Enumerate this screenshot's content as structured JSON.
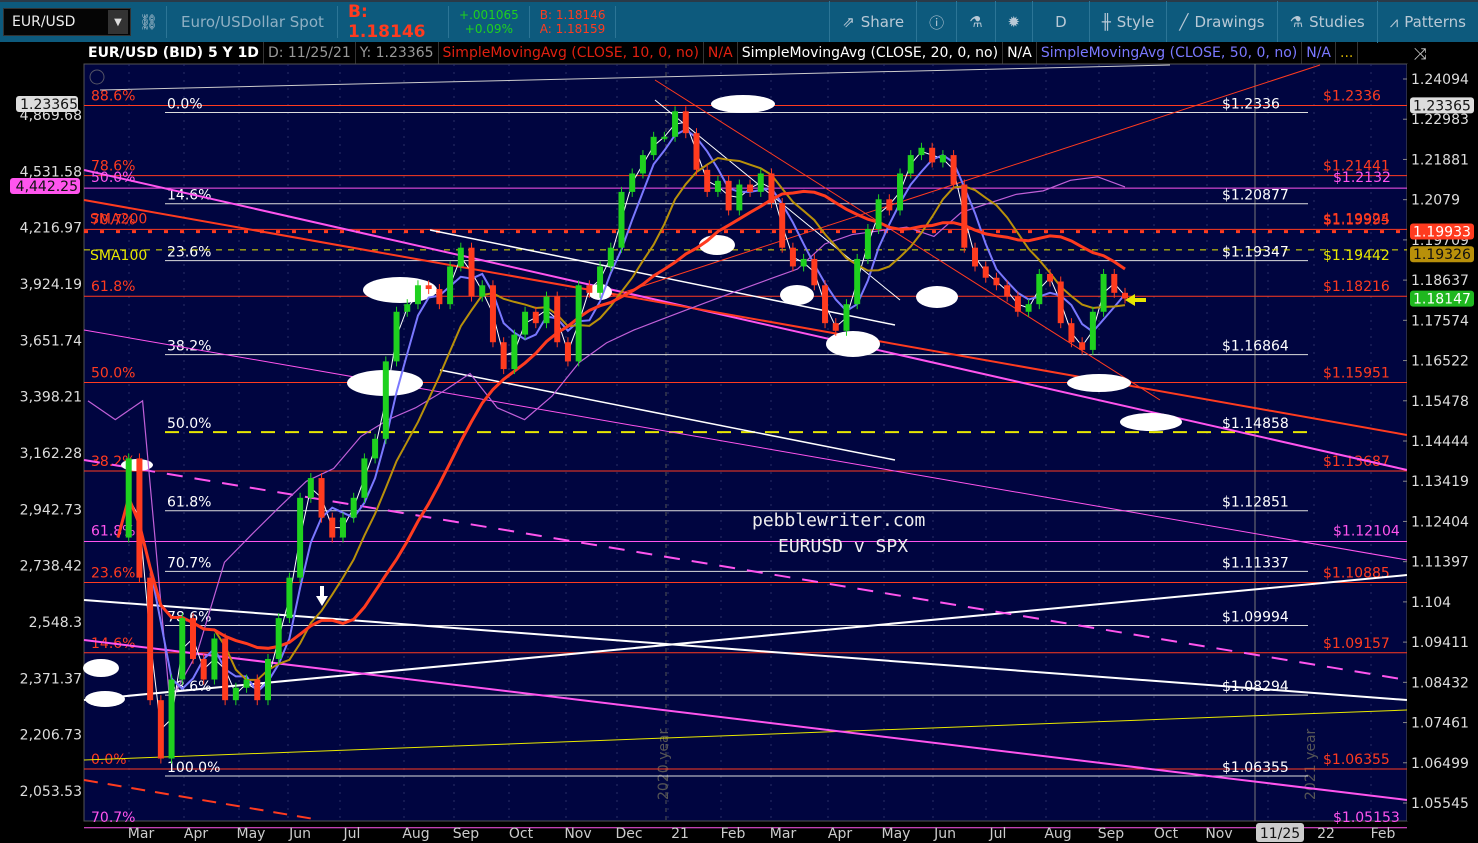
{
  "toolbar": {
    "symbol": "EUR/USD",
    "description": "Euro/USDollar Spot",
    "bid_big": "B: 1.18146",
    "change": "+.001065",
    "change_pct": "+0.09%",
    "bid": "B: 1.18146",
    "ask": "A: 1.18159",
    "buttons": [
      {
        "label": "Share",
        "icon": "share-icon"
      },
      {
        "label": "",
        "icon": "info-icon"
      },
      {
        "label": "",
        "icon": "flask-icon"
      },
      {
        "label": "",
        "icon": "gear-icon"
      },
      {
        "label": "D",
        "icon": ""
      },
      {
        "label": "Style",
        "icon": "candle-icon"
      },
      {
        "label": "Drawings",
        "icon": "pencil-icon"
      },
      {
        "label": "Studies",
        "icon": "flask-icon"
      },
      {
        "label": "Patterns",
        "icon": "patterns-icon"
      }
    ]
  },
  "chart_header": {
    "title": "EUR/USD (BID) 5 Y 1D",
    "date": "D: 11/25/21",
    "y_value": "Y: 1.23365",
    "sma10": "SimpleMovingAvg (CLOSE, 10, 0, no)",
    "sma10_val": "N/A",
    "sma20": "SimpleMovingAvg (CLOSE, 20, 0, no)",
    "sma20_val": "N/A",
    "sma50": "SimpleMovingAvg (CLOSE, 50, 0, no)",
    "sma50_val": "N/A",
    "more": "..."
  },
  "colors": {
    "red": "#ff3b1f",
    "magenta": "#ff55ee",
    "yellow": "#e8e800",
    "green": "#1fd11f",
    "blue": "#7a78ff",
    "gold": "#b8900a"
  },
  "chart_data": {
    "type": "line",
    "title": "EUR/USD (BID) 5 Y 1D",
    "watermark": [
      "pebblewriter.com",
      "EURUSD v SPX"
    ],
    "year_labels": [
      "2020 year",
      "2021 year"
    ],
    "right_axis": {
      "scale": "log",
      "range": [
        1.05545,
        1.24094
      ],
      "ticks": [
        "1.24094",
        "1.22983",
        "1.21881",
        "1.2079",
        "1.19709",
        "1.18637",
        "1.17574",
        "1.16522",
        "1.15478",
        "1.14444",
        "1.13419",
        "1.12404",
        "1.11397",
        "1.104",
        "1.09411",
        "1.08432",
        "1.07461",
        "1.06499",
        "1.05545"
      ]
    },
    "left_axis": {
      "scale": "log",
      "range": [
        2053.53,
        4869.68
      ],
      "ticks": [
        "4,869.68",
        "4,531.58",
        "4,216.97",
        "3,924.19",
        "3,651.74",
        "3,398.21",
        "3,162.28",
        "2,942.73",
        "2,738.42",
        "2,548.3",
        "2,371.37",
        "2,206.73",
        "2,053.53"
      ]
    },
    "x_ticks": [
      "Mar",
      "Apr",
      "May",
      "Jun",
      "Jul",
      "Aug",
      "Sep",
      "Oct",
      "Nov",
      "Dec",
      "21",
      "Feb",
      "Mar",
      "Apr",
      "May",
      "Jun",
      "Jul",
      "Aug",
      "Sep",
      "Oct",
      "Nov",
      "11/25",
      "22",
      "Feb"
    ],
    "series": [
      {
        "name": "EUR/USD",
        "axis": "right",
        "values": [
          1.12,
          1.14,
          1.11,
          1.08,
          1.066,
          1.085,
          1.1,
          1.09,
          1.085,
          1.095,
          1.08,
          1.083,
          1.085,
          1.08,
          1.09,
          1.1,
          1.11,
          1.13,
          1.135,
          1.125,
          1.12,
          1.125,
          1.13,
          1.14,
          1.145,
          1.165,
          1.178,
          1.18,
          1.185,
          1.184,
          1.18,
          1.19,
          1.195,
          1.182,
          1.185,
          1.17,
          1.163,
          1.172,
          1.178,
          1.175,
          1.182,
          1.17,
          1.165,
          1.185,
          1.183,
          1.19,
          1.195,
          1.21,
          1.215,
          1.22,
          1.225,
          1.225,
          1.232,
          1.226,
          1.216,
          1.21,
          1.213,
          1.205,
          1.212,
          1.21,
          1.215,
          1.207,
          1.195,
          1.19,
          1.192,
          1.185,
          1.175,
          1.173,
          1.18,
          1.192,
          1.2,
          1.208,
          1.205,
          1.215,
          1.22,
          1.222,
          1.218,
          1.22,
          1.212,
          1.195,
          1.19,
          1.187,
          1.185,
          1.182,
          1.178,
          1.18,
          1.188,
          1.186,
          1.175,
          1.17,
          1.168,
          1.178,
          1.188,
          1.183,
          1.1815
        ]
      },
      {
        "name": "SPX",
        "axis": "left",
        "values": [
          3380,
          3300,
          3380,
          2300,
          2450,
          2750,
          2850,
          2950,
          3050,
          3100,
          3230,
          3300,
          3350,
          3420,
          3500,
          3350,
          3300,
          3400,
          3550,
          3640,
          3700,
          3750,
          3800,
          3850,
          3900,
          3950,
          4000,
          4130,
          4180,
          4200,
          4220,
          4170,
          4300,
          4350,
          4400,
          4420,
          4480,
          4500,
          4442
        ]
      }
    ],
    "fib_white": [
      {
        "pct": "0.0%",
        "price": "$1.2336",
        "v": 1.2336
      },
      {
        "pct": "14.6%",
        "price": "$1.20877",
        "v": 1.2087
      },
      {
        "pct": "23.6%",
        "price": "$1.19347",
        "v": 1.1934
      },
      {
        "pct": "38.2%",
        "price": "$1.16864",
        "v": 1.1686
      },
      {
        "pct": "50.0%",
        "price": "$1.14858",
        "v": 1.1485
      },
      {
        "pct": "61.8%",
        "price": "$1.12851",
        "v": 1.1285
      },
      {
        "pct": "70.7%",
        "price": "$1.11337",
        "v": 1.1133
      },
      {
        "pct": "78.6%",
        "price": "$1.09994",
        "v": 1.0999
      },
      {
        "pct": "88.6%",
        "price": "$1.08294",
        "v": 1.0829
      },
      {
        "pct": "100.0%",
        "price": "$1.06355",
        "v": 1.0635
      }
    ],
    "fib_red": [
      {
        "pct": "88.6%",
        "price": "$1.2336",
        "v": 1.2336
      },
      {
        "pct": "78.6%",
        "price": "$1.21441",
        "v": 1.2144
      },
      {
        "pct": "70.7%",
        "price": "$1.19995",
        "v": 1.1999
      },
      {
        "pct": "61.8%",
        "price": "$1.18216",
        "v": 1.1821
      },
      {
        "pct": "50.0%",
        "price": "$1.15951",
        "v": 1.1595
      },
      {
        "pct": "38.2%",
        "price": "$1.13687",
        "v": 1.1368
      },
      {
        "pct": "23.6%",
        "price": "$1.10885",
        "v": 1.1088
      },
      {
        "pct": "14.6%",
        "price": "$1.09157",
        "v": 1.0915
      },
      {
        "pct": "0.0%",
        "price": "$1.06355",
        "v": 1.0635
      }
    ],
    "fib_magenta": [
      {
        "pct": "50.0%",
        "price": "$1.2132",
        "v": 1.2132
      },
      {
        "pct": "61.8%",
        "price": "$1.12104",
        "v": 1.121
      },
      {
        "pct": "70.7%",
        "price": "$1.05153",
        "v": 1.0515
      }
    ],
    "sma_labels": [
      {
        "name": "SMA200",
        "price": "$1.19924",
        "v": 1.1993
      },
      {
        "name": "SMA100",
        "price": "$1.19442",
        "v": 1.1944
      }
    ],
    "right_tags": [
      {
        "label": "1.23365",
        "v": 1.23365,
        "bg": "#dddddd",
        "fg": "#111"
      },
      {
        "label": "1.19933",
        "v": 1.19933,
        "bg": "#ff3b1f",
        "fg": "#fff"
      },
      {
        "label": "1.19326",
        "v": 1.19326,
        "bg": "#b8900a",
        "fg": "#111"
      },
      {
        "label": "1.18147",
        "v": 1.18147,
        "bg": "#1fb81f",
        "fg": "#fff"
      }
    ],
    "left_tags": [
      {
        "label": "1.23365",
        "bg": "#dddddd",
        "fg": "#111"
      },
      {
        "label": "4,442.25",
        "bg": "#ff55ee",
        "fg": "#111"
      }
    ]
  }
}
